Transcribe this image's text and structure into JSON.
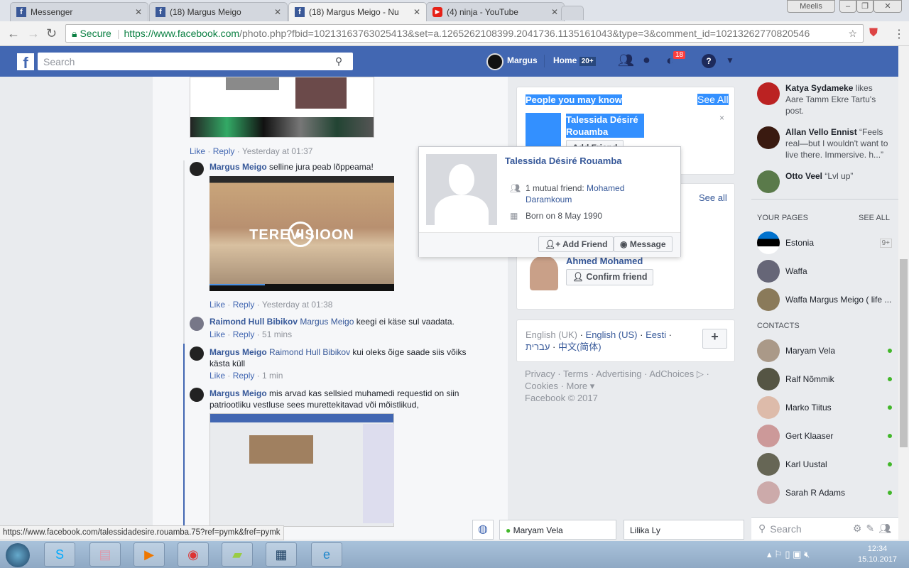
{
  "browser": {
    "tabs": [
      {
        "title": "Messenger",
        "icon": "facebook-icon"
      },
      {
        "title": "(18) Margus Meigo",
        "icon": "facebook-icon"
      },
      {
        "title": "(18) Margus Meigo - Nu",
        "icon": "facebook-icon"
      },
      {
        "title": "(4) ninja - YouTube",
        "icon": "youtube-icon"
      }
    ],
    "profile": "Meelis",
    "secure": "Secure",
    "url_host": "https://www.facebook.com",
    "url_path": "/photo.php?fbid=10213163763025413&set=a.1265262108399.2041736.1135161043&type=3&comment_id=10213262770820546"
  },
  "header": {
    "search_placeholder": "Search",
    "user": "Margus",
    "home": "Home",
    "home_badge": "20+",
    "notif_badge": "18"
  },
  "comments": [
    {
      "meta": [
        "Like",
        "Reply",
        "Yesterday at 01:37"
      ]
    },
    {
      "author": "Margus Meigo",
      "text": "selline jura peab lõppeama!",
      "video_title": "TEREVISIOON",
      "meta": [
        "Like",
        "Reply",
        "Yesterday at 01:38"
      ]
    },
    {
      "author": "Raimond Hull Bibikov",
      "mention": "Margus Meigo",
      "text": "keegi ei käse sul vaadata.",
      "meta": [
        "Like",
        "Reply",
        "51 mins"
      ]
    },
    {
      "author": "Margus Meigo",
      "mention": "Raimond Hull Bibikov",
      "text": "kui oleks õige saade siis võiks kästa küll",
      "meta": [
        "Like",
        "Reply",
        "1 min"
      ]
    },
    {
      "author": "Margus Meigo",
      "text": "mis arvad kas sellsied muhamedi requestid on siin patriootliku vestluse sees murettekitavad või mõistlikud,"
    }
  ],
  "pymk": {
    "title": "People you may know",
    "see_all": "See All",
    "name": "Talessida Désiré Rouamba",
    "add_friend": "Add Friend"
  },
  "requests": {
    "see_all": "See all",
    "name": "Ahmed Mohamed",
    "confirm": "Confirm friend"
  },
  "hovercard": {
    "name": "Talessida Désiré Rouamba",
    "mutual_prefix": "1 mutual friend: ",
    "mutual_name": "Mohamed Daramkoum",
    "born": "Born on 8 May 1990",
    "add_friend": "Add Friend",
    "message": "Message"
  },
  "languages": {
    "current": "English (UK)",
    "others": [
      "English (US)",
      "Eesti",
      "עברית",
      "中文(简体)"
    ]
  },
  "footer": {
    "links": [
      "Privacy",
      "Terms",
      "Advertising",
      "AdChoices",
      "Cookies",
      "More"
    ],
    "copyright": "Facebook © 2017"
  },
  "ticker": [
    {
      "name": "Katya Sydameke",
      "text": " likes Aare Tamm Ekre Tartu's post."
    },
    {
      "name": "Allan Vello Ennist",
      "text": " “Feels real—but I wouldn't want to live there. Immersive. h...”"
    },
    {
      "name": "Otto Veel",
      "text": " “Lvl up”"
    }
  ],
  "pages": {
    "title": "YOUR PAGES",
    "see_all": "SEE ALL",
    "items": [
      {
        "name": "Estonia",
        "badge": "9+"
      },
      {
        "name": "Waffa"
      },
      {
        "name": "Waffa Margus Meigo ( life ..."
      }
    ]
  },
  "contacts": {
    "title": "CONTACTS",
    "items": [
      "Maryam Vela",
      "Ralf Nõmmik",
      "Marko Tiitus",
      "Gert Klaaser",
      "Karl Uustal",
      "Sarah R Adams"
    ],
    "search_placeholder": "Search"
  },
  "chat_tabs": [
    "Maryam Vela",
    "Lilika Ly"
  ],
  "status_url": "https://www.facebook.com/talessidadesire.rouamba.75?ref=pymk&fref=pymk",
  "taskbar": {
    "time": "12:34",
    "date": "15.10.2017"
  },
  "colors": {
    "fb_blue": "#4267b2",
    "link": "#365899",
    "selection": "#3390ff",
    "online": "#42b72a"
  }
}
